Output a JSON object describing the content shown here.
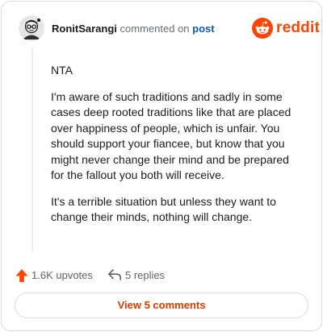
{
  "header": {
    "username": "RonitSarangi",
    "action": "commented on",
    "post_link": "post",
    "brand": "reddit"
  },
  "comment": {
    "paragraphs": [
      "NTA",
      "I'm aware of such traditions and sadly in some cases deep rooted traditions like that are placed over happiness of people, which is unfair. You should support your fiancee, but know that you might never change their mind and be prepared for the fallout you both will receive.",
      "It's a terrible situation but unless they want to change their minds, nothing will change."
    ]
  },
  "actions": {
    "upvotes": "1.6K upvotes",
    "replies": "5 replies"
  },
  "view_button": "View 5 comments",
  "colors": {
    "brand": "#ff4500",
    "link": "#0d5bb5",
    "view_button_text": "#d93a00"
  },
  "icons": [
    "avatar",
    "reddit-logo-icon",
    "upvote-arrow-icon",
    "reply-arrow-icon"
  ]
}
